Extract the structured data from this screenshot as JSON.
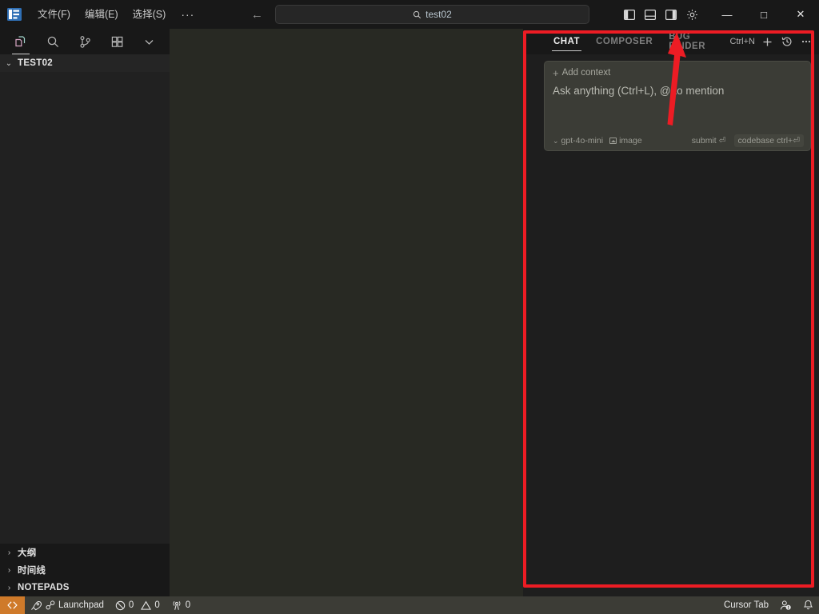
{
  "titlebar": {
    "logo_name": "cursor-logo-icon",
    "menus": [
      {
        "label": "文件(F)",
        "name": "menu-file"
      },
      {
        "label": "编辑(E)",
        "name": "menu-edit"
      },
      {
        "label": "选择(S)",
        "name": "menu-select"
      }
    ],
    "more_label": "···",
    "nav_back": "←",
    "nav_forward": "→",
    "search": {
      "value": "test02",
      "icon": "search-icon"
    },
    "layout_buttons": [
      {
        "name": "toggle-primary-sidebar",
        "title": "Toggle Primary Side Bar"
      },
      {
        "name": "toggle-panel",
        "title": "Toggle Panel"
      },
      {
        "name": "toggle-secondary-sidebar",
        "title": "Toggle Secondary Side Bar"
      }
    ],
    "settings_icon": "gear-icon",
    "window": {
      "minimize": "—",
      "maximize": "□",
      "close": "✕"
    }
  },
  "activitybar": {
    "items": [
      {
        "name": "activity-explorer",
        "icon": "files-icon",
        "active": true
      },
      {
        "name": "activity-search",
        "icon": "search-icon",
        "active": false
      },
      {
        "name": "activity-source-control",
        "icon": "source-control-icon",
        "active": false
      },
      {
        "name": "activity-extensions",
        "icon": "extensions-icon",
        "active": false
      },
      {
        "name": "activity-more",
        "icon": "chevron-down-icon",
        "active": false
      }
    ]
  },
  "explorer": {
    "root_label": "TEST02",
    "root_chevron": "⌄",
    "sections": [
      {
        "label": "大纲",
        "name": "sidebar-section-outline"
      },
      {
        "label": "时间线",
        "name": "sidebar-section-timeline"
      },
      {
        "label": "NOTEPADS",
        "name": "sidebar-section-notepads"
      }
    ]
  },
  "chat": {
    "tabs": [
      {
        "label": "CHAT",
        "name": "tab-chat",
        "active": true
      },
      {
        "label": "COMPOSER",
        "name": "tab-composer",
        "active": false
      },
      {
        "label": "BUG FINDER",
        "name": "tab-bug-finder",
        "active": false
      }
    ],
    "new_chat_shortcut": "Ctrl+N",
    "new_chat_icon": "plus-icon",
    "history_icon": "history-icon",
    "more_icon": "ellipsis-icon",
    "composer": {
      "add_context_label": "Add context",
      "add_context_plus": "+",
      "placeholder": "Ask anything (Ctrl+L), @ to mention",
      "model": "gpt-4o-mini",
      "model_chevron": "⌄",
      "image_label": "image",
      "submit_label": "submit",
      "submit_key": "⏎",
      "codebase_label": "codebase",
      "codebase_key": "ctrl+⏎"
    }
  },
  "annotation": {
    "color": "#ed1c24",
    "rect_name": "annotation-rectangle",
    "arrow_name": "annotation-arrow"
  },
  "statusbar": {
    "remote_icon": "remote-window-icon",
    "launchpad": {
      "label": "Launchpad",
      "icon": "rocket-icon",
      "secondary_icon": "link-icon"
    },
    "errors": {
      "icon": "error-icon",
      "count": "0"
    },
    "warnings": {
      "icon": "warning-icon",
      "count": "0"
    },
    "ports": {
      "icon": "radio-tower-icon",
      "count": "0"
    },
    "cursor_tab": "Cursor Tab",
    "account_icon": "account-icon",
    "bell_icon": "bell-icon"
  },
  "colors": {
    "titlebar_bg": "#181818",
    "editor_bg": "#282923",
    "sidebar_bg": "#212121",
    "panel_bg": "#1e1e1e",
    "composer_bg": "#3b3c36",
    "status_bg": "#3c3c36",
    "remote_bg": "#cf7a2a",
    "annotation_red": "#ed1c24"
  }
}
